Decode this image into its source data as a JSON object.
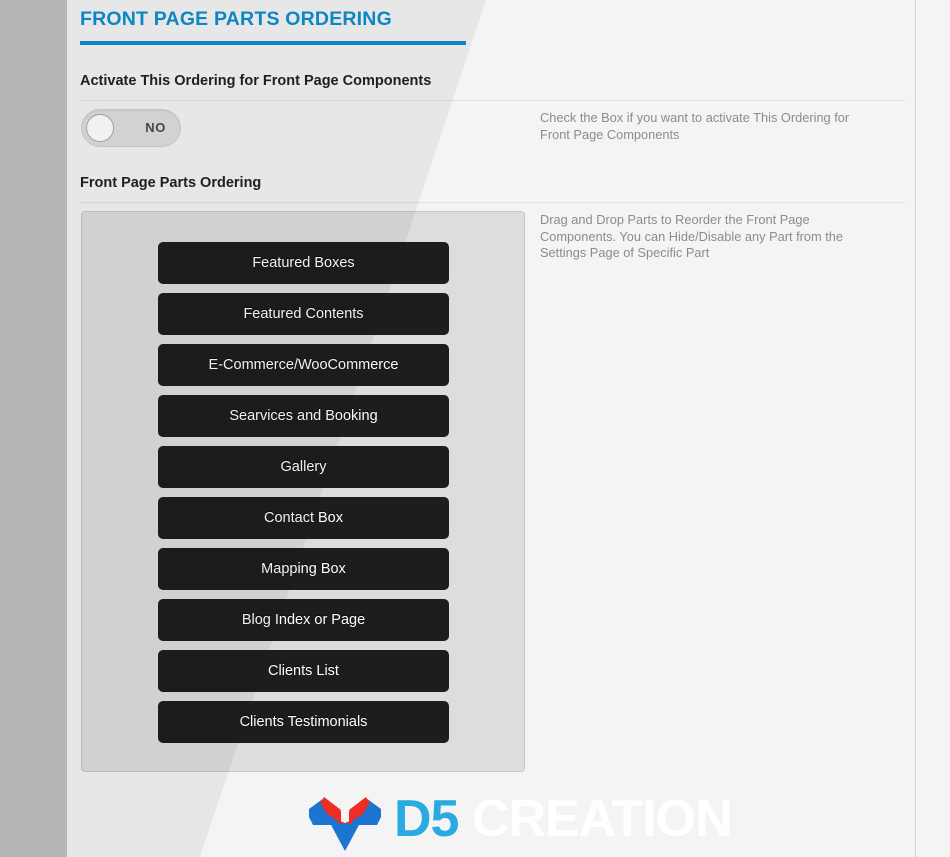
{
  "page": {
    "title": "FRONT PAGE PARTS ORDERING",
    "accent_color": "#0d8ecf"
  },
  "fields": [
    {
      "label": "Activate This Ordering for Front Page Components",
      "description": "Check the Box if you want to activate This Ordering for Front Page Components",
      "toggle": {
        "state_label": "NO",
        "checked": false
      }
    },
    {
      "label": "Front Page Parts Ordering",
      "description": "Drag and Drop Parts to Reorder the Front Page Components. You can Hide/Disable any Part from the Settings Page of Specific Part"
    }
  ],
  "sortable_parts": [
    "Featured Boxes",
    "Featured Contents",
    "E-Commerce/WooCommerce",
    "Searvices and Booking",
    "Gallery",
    "Contact Box",
    "Mapping Box",
    "Blog Index or Page",
    "Clients List",
    "Clients Testimonials"
  ],
  "footer_logo": {
    "brand_primary": "D5",
    "brand_secondary": "CREATION",
    "primary_color": "#29abe2",
    "secondary_color": "#ffffff",
    "mark_blue": "#1b75d1",
    "mark_red": "#ee2d24"
  }
}
